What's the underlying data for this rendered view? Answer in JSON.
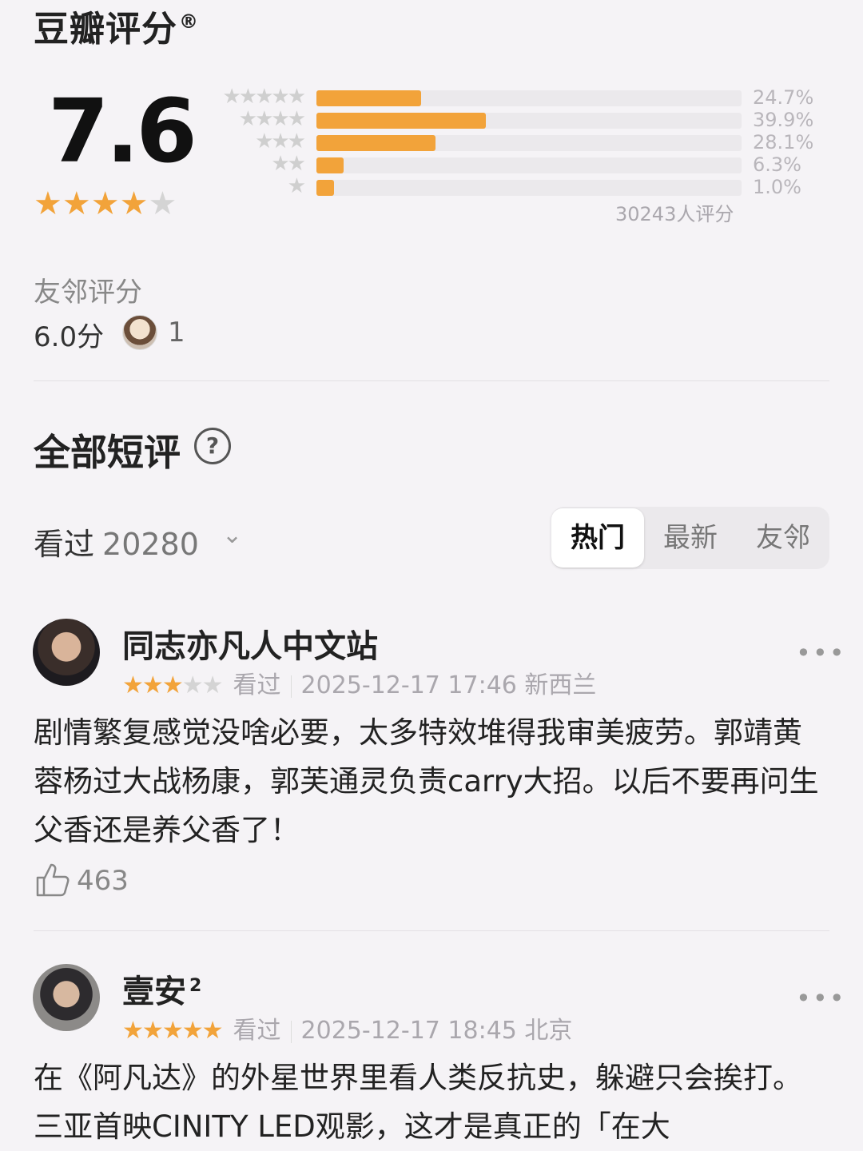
{
  "rating": {
    "title": "豆瓣评分",
    "registered_mark": "®",
    "score": "7.6",
    "stars": 4,
    "distribution": [
      {
        "stars": 5,
        "percent": 24.7,
        "label": "24.7%"
      },
      {
        "stars": 4,
        "percent": 39.9,
        "label": "39.9%"
      },
      {
        "stars": 3,
        "percent": 28.1,
        "label": "28.1%"
      },
      {
        "stars": 2,
        "percent": 6.3,
        "label": "6.3%"
      },
      {
        "stars": 1,
        "percent": 1.0,
        "label": "1.0%"
      }
    ],
    "total_label": "30243人评分"
  },
  "friends": {
    "label": "友邻评分",
    "score": "6.0分",
    "count": "1"
  },
  "reviews_section": {
    "title": "全部短评",
    "help_glyph": "?",
    "watched_label": "看过",
    "watched_count": "20280",
    "chevron": "⌄",
    "tabs": [
      {
        "label": "热门",
        "active": true
      },
      {
        "label": "最新",
        "active": false
      },
      {
        "label": "友邻",
        "active": false
      }
    ]
  },
  "reviews": [
    {
      "user": "同志亦凡人中文站",
      "badge": "",
      "stars": 3,
      "status": "看过",
      "datetime": "2025-12-17 17:46 新西兰",
      "text": "剧情繁复感觉没啥必要，太多特效堆得我审美疲劳。郭靖黄蓉杨过大战杨康，郭芙通灵负责carry大招。以后不要再问生父香还是养父香了！",
      "likes": "463"
    },
    {
      "user": "壹安",
      "badge": "2",
      "stars": 5,
      "status": "看过",
      "datetime": "2025-12-17 18:45 北京",
      "text": "在《阿凡达》的外星世界里看人类反抗史，躲避只会挨打。三亚首映CINITY LED观影，这才是真正的「在大",
      "likes": ""
    }
  ],
  "colors": {
    "accent": "#f2a33a",
    "background": "#f5f3f6",
    "track": "#ebe9ec"
  }
}
